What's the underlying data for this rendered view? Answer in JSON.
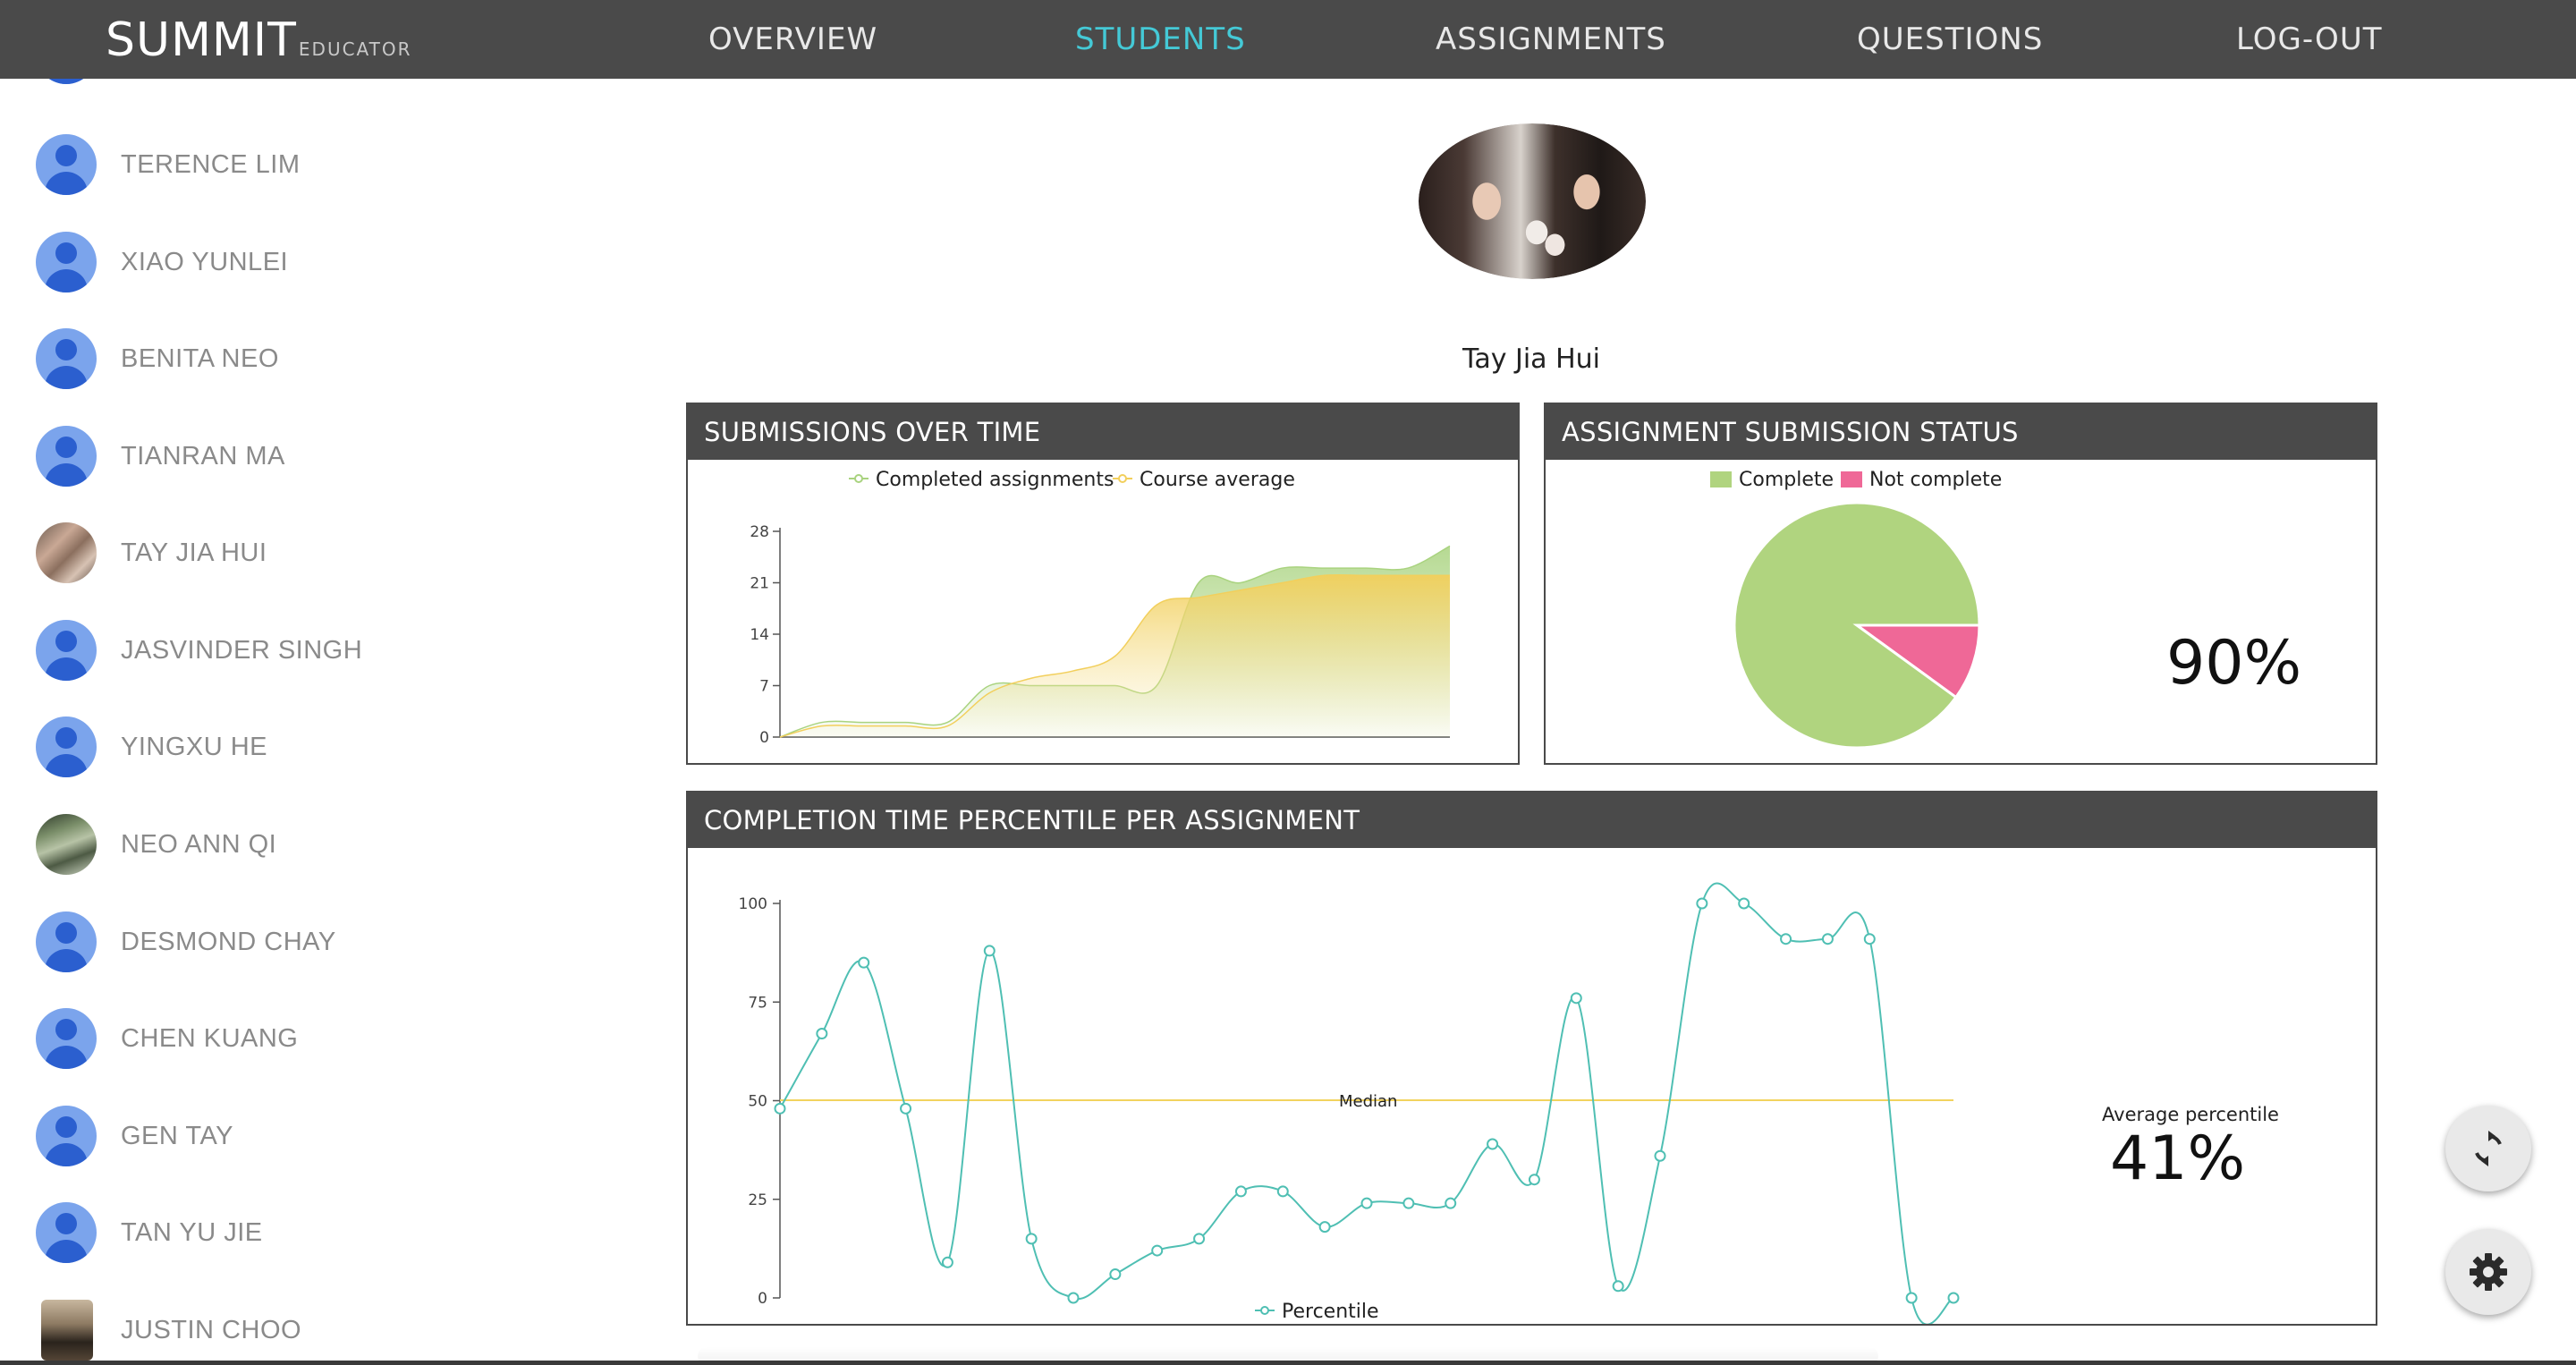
{
  "brand": {
    "main": "SUMMIT",
    "sub": "EDUCATOR"
  },
  "nav": [
    {
      "label": "OVERVIEW",
      "active": false
    },
    {
      "label": "STUDENTS",
      "active": true
    },
    {
      "label": "ASSIGNMENTS",
      "active": false
    },
    {
      "label": "QUESTIONS",
      "active": false
    },
    {
      "label": "LOG-OUT",
      "active": false
    }
  ],
  "students": [
    {
      "name": "TERENCE LIM",
      "avatar": "default"
    },
    {
      "name": "XIAO YUNLEI",
      "avatar": "default"
    },
    {
      "name": "BENITA NEO",
      "avatar": "default"
    },
    {
      "name": "TIANRAN MA",
      "avatar": "default"
    },
    {
      "name": "TAY JIA HUI",
      "avatar": "photo"
    },
    {
      "name": "JASVINDER SINGH",
      "avatar": "default"
    },
    {
      "name": "YINGXU HE",
      "avatar": "default"
    },
    {
      "name": "NEO ANN QI",
      "avatar": "photo"
    },
    {
      "name": "DESMOND CHAY",
      "avatar": "default"
    },
    {
      "name": "CHEN KUANG",
      "avatar": "default"
    },
    {
      "name": "GEN TAY",
      "avatar": "default"
    },
    {
      "name": "TAN YU JIE",
      "avatar": "default"
    },
    {
      "name": "JUSTIN CHOO",
      "avatar": "photo"
    }
  ],
  "profile": {
    "name": "Tay Jia Hui"
  },
  "panels": {
    "submissions": {
      "title": "SUBMISSIONS OVER TIME"
    },
    "status": {
      "title": "ASSIGNMENT SUBMISSION STATUS",
      "percent": "90%"
    },
    "completion": {
      "title": "COMPLETION TIME PERCENTILE PER ASSIGNMENT",
      "avg_label": "Average percentile",
      "avg_value": "41%"
    }
  },
  "colors": {
    "nav_bg": "#4a4a4a",
    "nav_active": "#44c9d6",
    "completed": "#a9d37f",
    "course_avg": "#f2cf5c",
    "complete": "#b0d47f",
    "not_complete": "#ef6897",
    "percentile": "#4fbfb3",
    "median": "#f2d35e"
  },
  "icons": {
    "refresh": "refresh-icon",
    "settings": "gear-icon"
  },
  "chart_data": [
    {
      "type": "area",
      "series": [
        {
          "name": "Completed assignments",
          "x": [
            0,
            1,
            2,
            3,
            4,
            5,
            6,
            7,
            8,
            9,
            10,
            11,
            12,
            13,
            14,
            15,
            16
          ],
          "values": [
            0,
            2,
            2,
            2,
            2,
            7,
            7,
            7,
            7,
            7,
            21,
            21,
            23,
            23,
            23,
            23,
            26
          ]
        },
        {
          "name": "Course average",
          "x": [
            0,
            1,
            2,
            3,
            4,
            5,
            6,
            7,
            8,
            9,
            10,
            11,
            12,
            13,
            14,
            15,
            16
          ],
          "values": [
            0,
            1.5,
            1.5,
            1.5,
            1.5,
            6,
            8,
            9,
            11,
            18,
            19,
            20,
            21,
            22,
            22,
            22,
            22
          ]
        }
      ],
      "yticks": [
        0,
        7,
        14,
        21,
        28
      ],
      "ylim": [
        0,
        28
      ]
    },
    {
      "type": "pie",
      "labels": [
        "Complete",
        "Not complete"
      ],
      "values": [
        90,
        10
      ]
    },
    {
      "type": "line",
      "series": [
        {
          "name": "Percentile",
          "values": [
            48,
            67,
            85,
            48,
            9,
            88,
            15,
            0,
            6,
            12,
            15,
            27,
            27,
            18,
            24,
            24,
            24,
            39,
            30,
            76,
            3,
            36,
            100,
            100,
            91,
            91,
            91,
            0,
            0
          ]
        }
      ],
      "reference_line": {
        "label": "Median",
        "value": 50
      },
      "yticks": [
        0,
        25,
        50,
        75,
        100
      ],
      "ylim": [
        0,
        100
      ]
    }
  ]
}
